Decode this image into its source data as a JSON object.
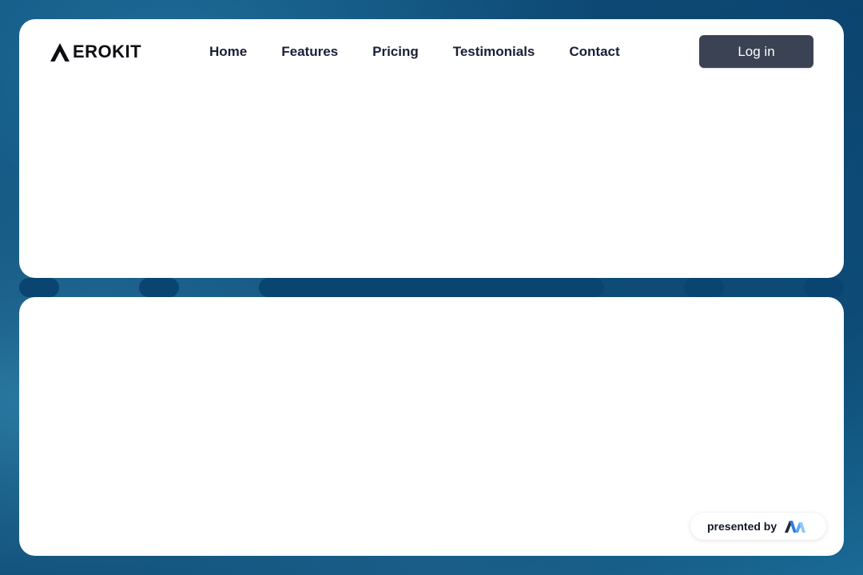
{
  "brand": {
    "name": "EROKIT",
    "logo_icon": "aerokit-a-icon"
  },
  "nav": {
    "items": [
      {
        "label": "Home"
      },
      {
        "label": "Features"
      },
      {
        "label": "Pricing"
      },
      {
        "label": "Testimonials"
      },
      {
        "label": "Contact"
      }
    ],
    "login_label": "Log in"
  },
  "footer_badge": {
    "label": "presented by",
    "icon": "presenter-logo-icon"
  },
  "colors": {
    "background": "#0b4570",
    "card": "#ffffff",
    "login_button": "#3b4254",
    "text": "#1a1f36"
  }
}
